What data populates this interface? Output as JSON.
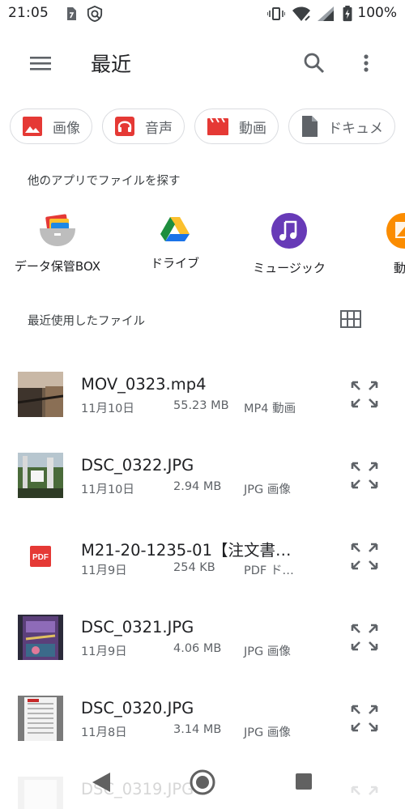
{
  "status_bar": {
    "time": "21:05",
    "battery_percent": "100%",
    "icons": [
      "storage-icon",
      "shield-icon",
      "vibrate-icon",
      "wifi-icon",
      "signal-icon",
      "battery-icon"
    ]
  },
  "app_bar": {
    "title": "最近",
    "icons": [
      "menu-icon",
      "search-icon",
      "more-vert-icon"
    ]
  },
  "chips": [
    {
      "label": "画像",
      "icon": "image-icon",
      "color": "#e53935"
    },
    {
      "label": "音声",
      "icon": "headphones-icon",
      "color": "#e53935"
    },
    {
      "label": "動画",
      "icon": "movie-icon",
      "color": "#e53935"
    },
    {
      "label": "ドキュメ",
      "icon": "document-icon",
      "color": "#5f6368"
    }
  ],
  "other_apps": {
    "heading": "他のアプリでファイルを探す",
    "apps": [
      {
        "label": "データ保管BOX",
        "icon": "data-box-icon"
      },
      {
        "label": "ドライブ",
        "icon": "drive-icon"
      },
      {
        "label": "ミュージック",
        "icon": "music-icon"
      },
      {
        "label": "動",
        "icon": "video-app-icon"
      }
    ]
  },
  "recent": {
    "heading": "最近使用したファイル",
    "view_toggle_icon": "grid-view-icon",
    "files": [
      {
        "name": "MOV_0323.mp4",
        "date": "11月10日",
        "size": "55.23 MB",
        "type": "MP4 動画",
        "thumb": "video-thumb"
      },
      {
        "name": "DSC_0322.JPG",
        "date": "11月10日",
        "size": "2.94 MB",
        "type": "JPG 画像",
        "thumb": "photo-thumb"
      },
      {
        "name": "M21-20-1235-01【注文書…",
        "date": "11月9日",
        "size": "254 KB",
        "type": "PDF ド…",
        "thumb": "pdf-icon",
        "thumb_label": "PDF"
      },
      {
        "name": "DSC_0321.JPG",
        "date": "11月9日",
        "size": "4.06 MB",
        "type": "JPG 画像",
        "thumb": "photo-thumb"
      },
      {
        "name": "DSC_0320.JPG",
        "date": "11月8日",
        "size": "3.14 MB",
        "type": "JPG 画像",
        "thumb": "photo-thumb"
      },
      {
        "name": "DSC_0319.JPG",
        "date": "",
        "size": "",
        "type": "",
        "thumb": "photo-thumb"
      }
    ]
  },
  "nav_bar": {
    "icons": [
      "back-icon",
      "home-icon",
      "recents-icon"
    ]
  }
}
